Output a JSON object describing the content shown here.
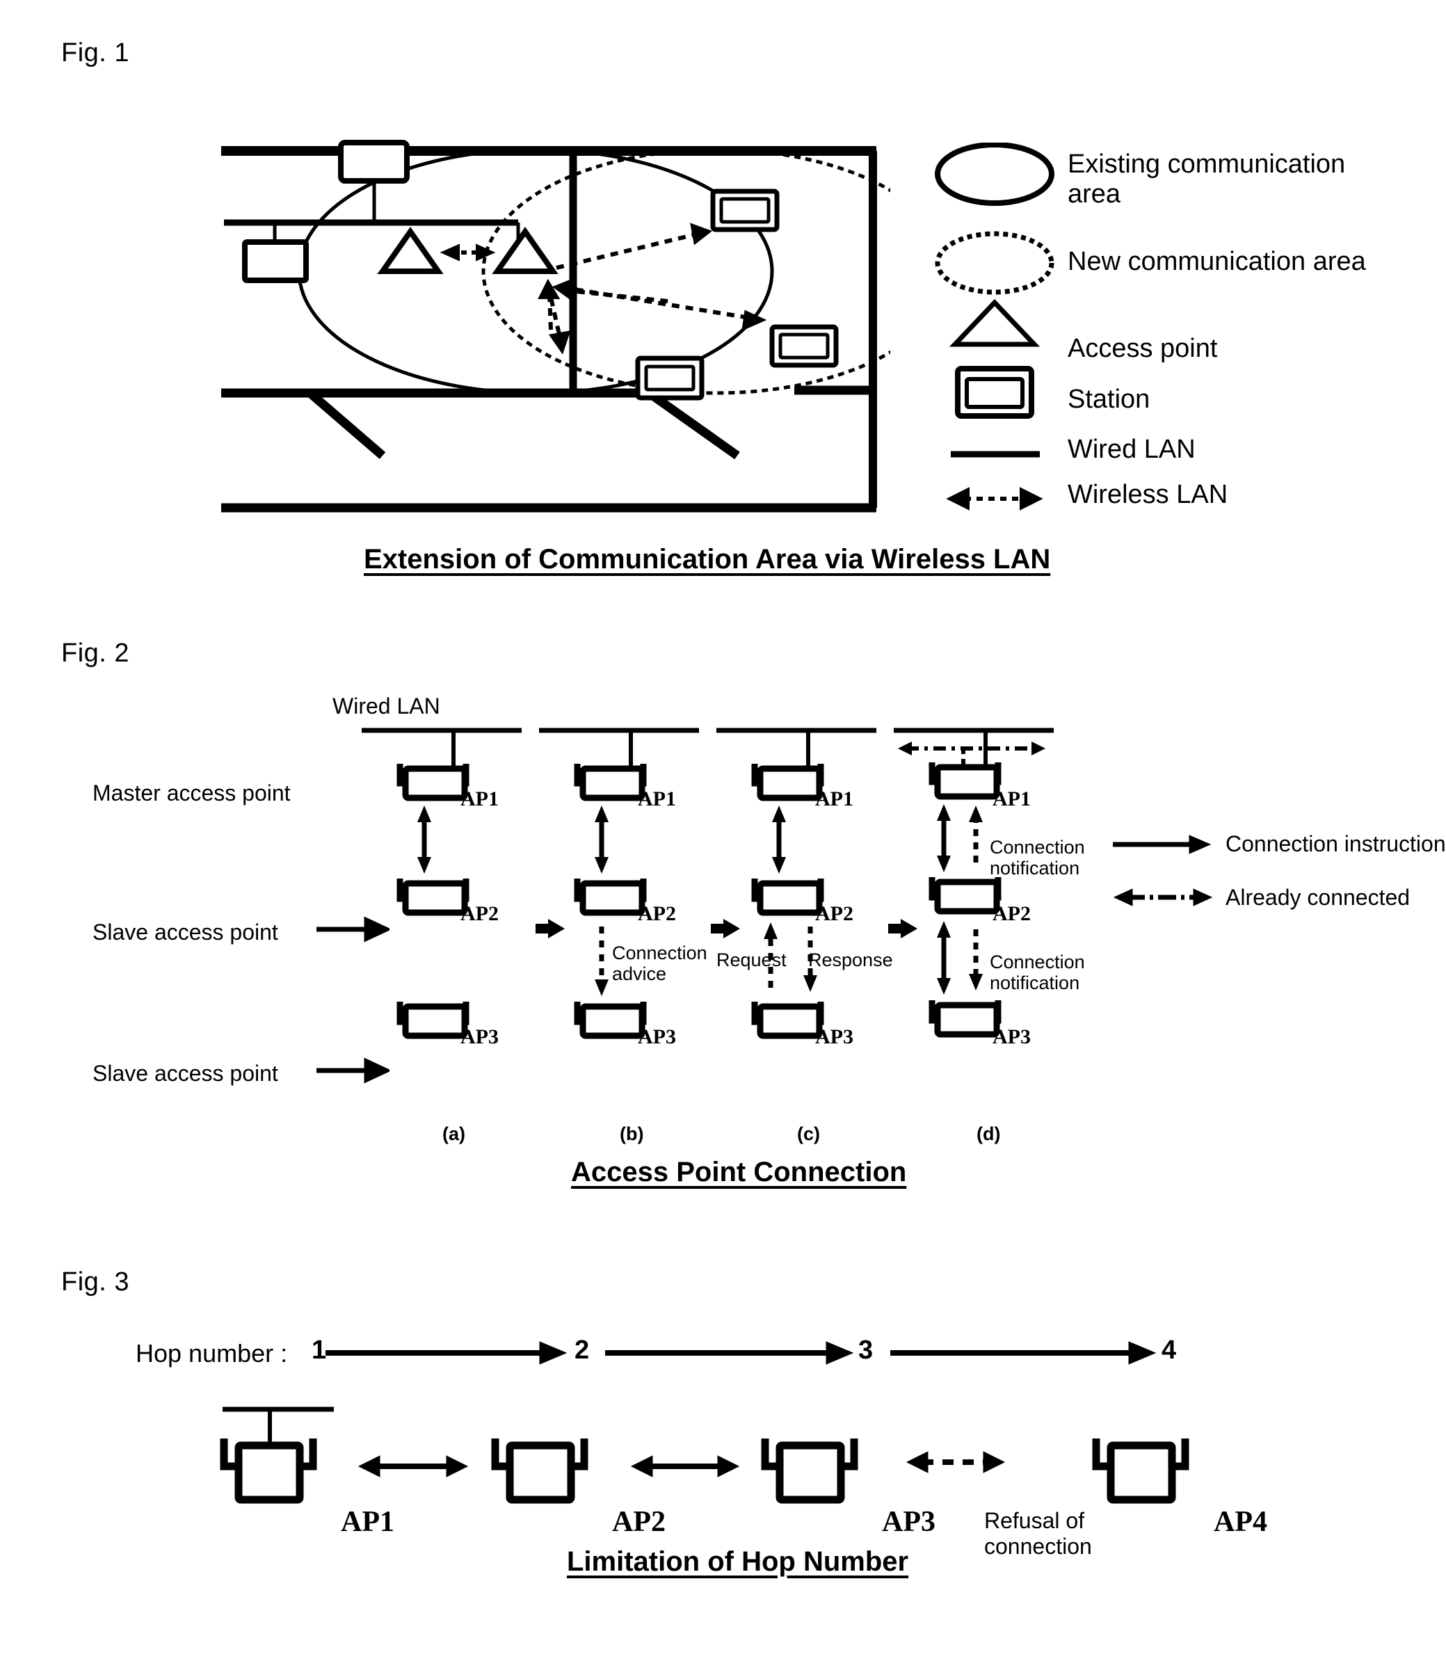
{
  "figures": [
    {
      "id": "fig1",
      "label": "Fig. 1",
      "caption": "Extension of Communication Area via Wireless LAN",
      "legend": [
        {
          "icon": "ellipse-solid-icon",
          "label": "Existing communication\narea"
        },
        {
          "icon": "ellipse-dashed-icon",
          "label": "New communication area"
        },
        {
          "icon": "triangle-icon",
          "label": "Access point"
        },
        {
          "icon": "station-box-icon",
          "label": "Station"
        },
        {
          "icon": "solid-line-icon",
          "label": "Wired LAN"
        },
        {
          "icon": "dashed-double-arrow-icon",
          "label": "Wireless LAN"
        }
      ]
    },
    {
      "id": "fig2",
      "label": "Fig. 2",
      "caption": "Access Point Connection",
      "wired_lan_label": "Wired LAN",
      "row_labels": [
        "Master access point",
        "Slave access point",
        "Slave access point"
      ],
      "panels": [
        {
          "letter": "(a)",
          "nodes": [
            "AP1",
            "AP2",
            "AP3"
          ],
          "annotations": []
        },
        {
          "letter": "(b)",
          "nodes": [
            "AP1",
            "AP2",
            "AP3"
          ],
          "annotations": [
            "Connection\nadvice"
          ]
        },
        {
          "letter": "(c)",
          "nodes": [
            "AP1",
            "AP2",
            "AP3"
          ],
          "annotations": [
            "Request",
            "Response"
          ]
        },
        {
          "letter": "(d)",
          "nodes": [
            "AP1",
            "AP2",
            "AP3"
          ],
          "annotations": [
            "Connection\nnotification",
            "Connection\nnotification"
          ]
        }
      ],
      "legend": [
        {
          "icon": "solid-arrow-icon",
          "label": "Connection instruction"
        },
        {
          "icon": "dashdot-arrow-icon",
          "label": "Already connected"
        }
      ]
    },
    {
      "id": "fig3",
      "label": "Fig. 3",
      "caption": "Limitation of Hop Number",
      "hop_prefix": "Hop number :",
      "hop_numbers": [
        "1",
        "2",
        "3",
        "4"
      ],
      "nodes": [
        "AP1",
        "AP2",
        "AP3",
        "AP4"
      ],
      "refusal_label": "Refusal of\nconnection"
    }
  ],
  "colors": {
    "ink": "#000000",
    "paper": "#ffffff"
  }
}
